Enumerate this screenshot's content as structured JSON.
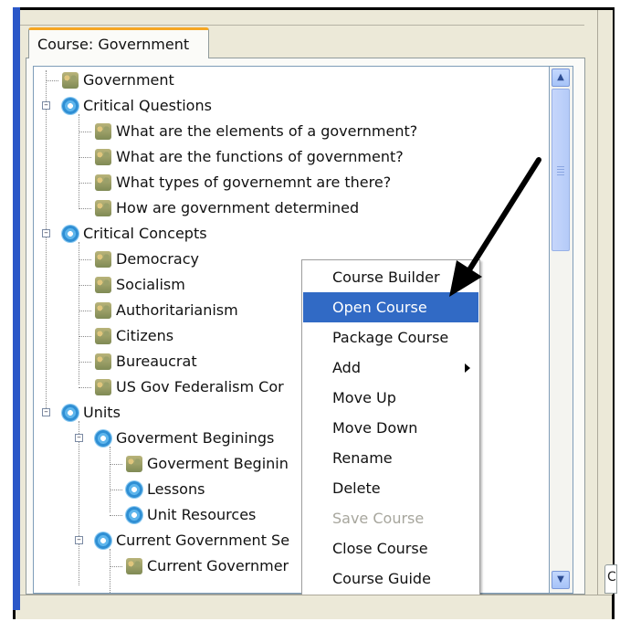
{
  "tab": {
    "title": "Course: Government"
  },
  "tree": {
    "items": [
      {
        "label": "Government",
        "icon": "people-icon"
      },
      {
        "label": "Critical Questions",
        "icon": "gear-icon"
      },
      {
        "label": "What are the elements of a government?",
        "icon": "people-icon"
      },
      {
        "label": "What are the functions of government?",
        "icon": "people-icon"
      },
      {
        "label": "What types of governemnt are there?",
        "icon": "people-icon"
      },
      {
        "label": "How are government determined",
        "icon": "people-icon"
      },
      {
        "label": "Critical Concepts",
        "icon": "gear-icon"
      },
      {
        "label": "Democracy",
        "icon": "people-icon"
      },
      {
        "label": "Socialism",
        "icon": "people-icon"
      },
      {
        "label": "Authoritarianism",
        "icon": "people-icon"
      },
      {
        "label": "Citizens",
        "icon": "people-icon"
      },
      {
        "label": "Bureaucrat",
        "icon": "people-icon"
      },
      {
        "label": "US Gov Federalism Cor",
        "icon": "people-icon"
      },
      {
        "label": "Units",
        "icon": "gear-icon"
      },
      {
        "label": "Goverment Beginings",
        "icon": "gear-icon"
      },
      {
        "label": "Goverment Beginin",
        "icon": "people-icon"
      },
      {
        "label": "Lessons",
        "icon": "gear-icon"
      },
      {
        "label": "Unit Resources",
        "icon": "gear-icon"
      },
      {
        "label": "Current Government Se",
        "icon": "gear-icon"
      },
      {
        "label": "Current Governmer",
        "icon": "people-icon"
      }
    ]
  },
  "context_menu": {
    "items": [
      {
        "label": "Course Builder",
        "state": "normal"
      },
      {
        "label": "Open Course",
        "state": "selected"
      },
      {
        "label": "Package Course",
        "state": "normal"
      },
      {
        "label": "Add",
        "state": "submenu"
      },
      {
        "label": "Move Up",
        "state": "normal"
      },
      {
        "label": "Move Down",
        "state": "normal"
      },
      {
        "label": "Rename",
        "state": "normal"
      },
      {
        "label": "Delete",
        "state": "normal"
      },
      {
        "label": "Save Course",
        "state": "disabled"
      },
      {
        "label": "Close Course",
        "state": "normal"
      },
      {
        "label": "Course Guide",
        "state": "normal"
      }
    ]
  },
  "right_tab": {
    "label": "C"
  },
  "colors": {
    "selection": "#316ac5",
    "tab_accent": "#f5a623",
    "frame_blue": "#2a57c8"
  }
}
